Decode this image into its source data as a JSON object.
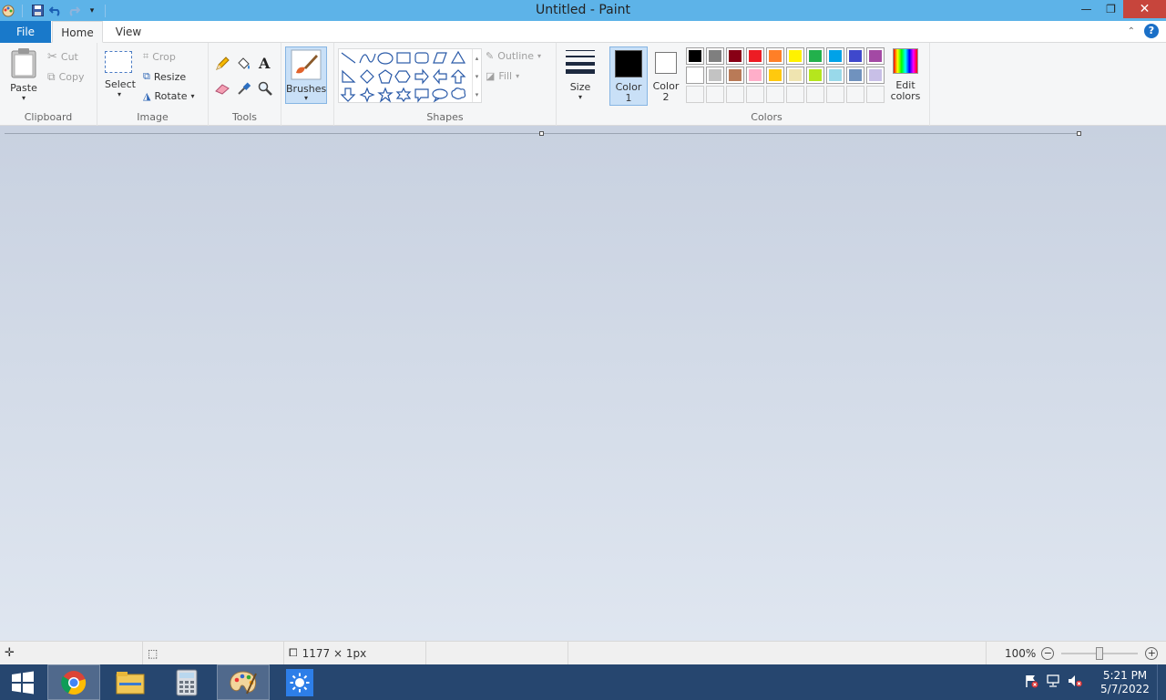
{
  "window": {
    "title": "Untitled - Paint",
    "minimize": "—",
    "maximize": "❐",
    "close": "✕"
  },
  "tabs": {
    "file": "File",
    "home": "Home",
    "view": "View",
    "help": "?"
  },
  "clipboard": {
    "paste": "Paste",
    "cut": "Cut",
    "copy": "Copy",
    "label": "Clipboard"
  },
  "image": {
    "select": "Select",
    "crop": "Crop",
    "resize": "Resize",
    "rotate": "Rotate",
    "label": "Image"
  },
  "tools": {
    "label": "Tools",
    "text_glyph": "A"
  },
  "brushes": {
    "label": "Brushes"
  },
  "shapes": {
    "outline": "Outline",
    "fill": "Fill",
    "label": "Shapes"
  },
  "size": {
    "label": "Size"
  },
  "colors": {
    "color1": "Color",
    "color1_num": "1",
    "color2": "Color",
    "color2_num": "2",
    "edit": "Edit",
    "edit2": "colors",
    "label": "Colors",
    "palette_row1": [
      "#000000",
      "#7f7f7f",
      "#880015",
      "#ed1c24",
      "#ff7f27",
      "#fff200",
      "#22b14c",
      "#00a2e8",
      "#3f48cc",
      "#a349a4"
    ],
    "palette_row2": [
      "#ffffff",
      "#c3c3c3",
      "#b97a57",
      "#ffaec9",
      "#ffc90e",
      "#efe4b0",
      "#b5e61d",
      "#99d9ea",
      "#7092be",
      "#c8bfe7"
    ]
  },
  "status": {
    "dimensions": "1177 × 1px",
    "zoom": "100%",
    "zoom_level": 0.5
  },
  "taskbar": {
    "time": "5:21 PM",
    "date": "5/7/2022"
  }
}
